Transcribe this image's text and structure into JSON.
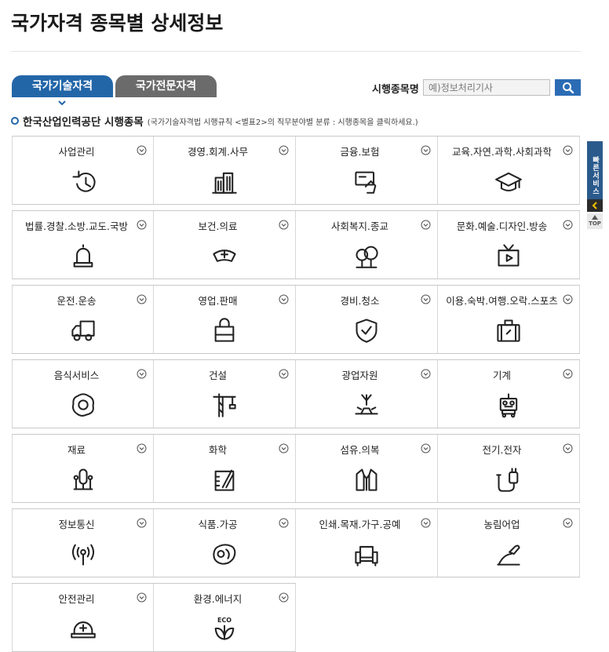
{
  "page": {
    "title": "국가자격 종목별 상세정보"
  },
  "tabs": [
    {
      "label": "국가기술자격",
      "active": true
    },
    {
      "label": "국가전문자격",
      "active": false
    }
  ],
  "search": {
    "label": "시행종목명",
    "placeholder": "예)정보처리기사"
  },
  "section": {
    "title": "한국산업인력공단 시행종목",
    "note": "(국가기술자격법 시행규칙 <별표2>의 직무분야별 분류 : 시행종목을 클릭하세요.)"
  },
  "categories": [
    {
      "label": "사업관리",
      "icon": "clock-history-icon"
    },
    {
      "label": "경영.회계.사무",
      "icon": "buildings-icon"
    },
    {
      "label": "금융.보험",
      "icon": "card-hand-icon"
    },
    {
      "label": "교육.자연.과학.사회과학",
      "icon": "graduation-cap-icon"
    },
    {
      "label": "법률.경찰.소방.교도.국방",
      "icon": "siren-icon"
    },
    {
      "label": "보건.의료",
      "icon": "nurse-cap-icon"
    },
    {
      "label": "사회복지.종교",
      "icon": "trees-icon"
    },
    {
      "label": "문화.예술.디자인.방송",
      "icon": "tv-icon"
    },
    {
      "label": "운전.운송",
      "icon": "truck-icon"
    },
    {
      "label": "영업.판매",
      "icon": "shopping-bag-icon"
    },
    {
      "label": "경비.청소",
      "icon": "shield-check-icon"
    },
    {
      "label": "이용.숙박.여행.오락.스포츠",
      "icon": "suitcase-icon"
    },
    {
      "label": "음식서비스",
      "icon": "fried-egg-icon"
    },
    {
      "label": "건설",
      "icon": "crane-icon"
    },
    {
      "label": "광업자원",
      "icon": "mining-icon"
    },
    {
      "label": "기계",
      "icon": "robot-icon"
    },
    {
      "label": "재료",
      "icon": "material-icon"
    },
    {
      "label": "화학",
      "icon": "beaker-icon"
    },
    {
      "label": "섬유.의복",
      "icon": "jacket-icon"
    },
    {
      "label": "전기.전자",
      "icon": "plug-icon"
    },
    {
      "label": "정보통신",
      "icon": "antenna-icon"
    },
    {
      "label": "식품.가공",
      "icon": "meat-icon"
    },
    {
      "label": "인쇄.목재.가구.공예",
      "icon": "sofa-icon"
    },
    {
      "label": "농림어업",
      "icon": "shovel-icon"
    },
    {
      "label": "안전관리",
      "icon": "hard-hat-icon"
    },
    {
      "label": "환경.에너지",
      "icon": "eco-icon"
    }
  ],
  "side": {
    "quick_label": "빠른서비스",
    "top_label": "TOP"
  },
  "colors": {
    "accent": "#2366a8",
    "tab_inactive": "#6b6b6b",
    "search_button": "#2b6cb4"
  }
}
